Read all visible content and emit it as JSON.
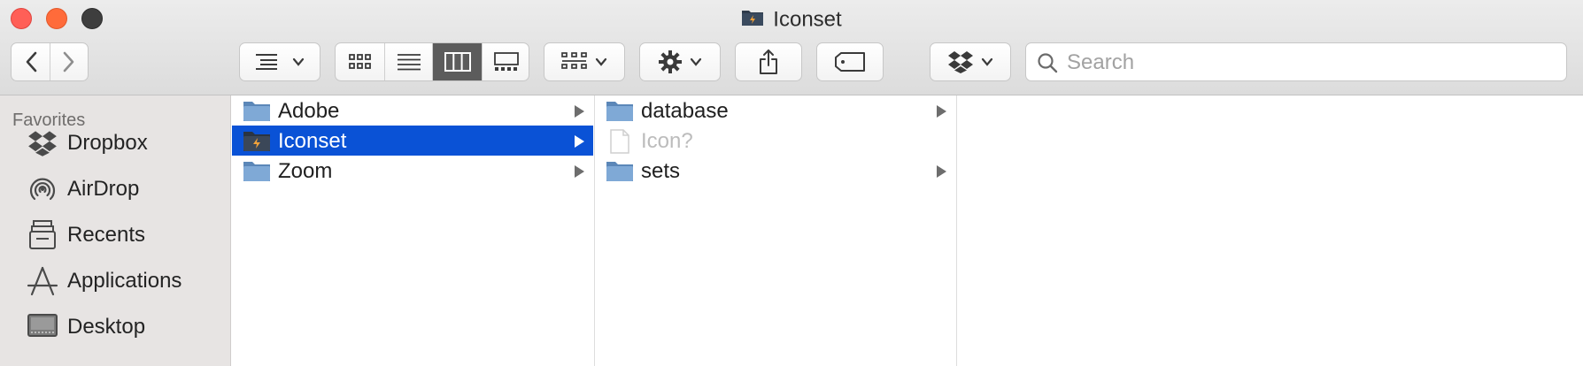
{
  "window": {
    "title": "Iconset",
    "title_icon": "dark-folder-icon"
  },
  "toolbar": {
    "back": "chevron-left-icon",
    "forward": "chevron-right-icon",
    "sort_menu": "list-sort-icon",
    "view_modes": [
      "icon-view-icon",
      "list-view-icon",
      "column-view-icon",
      "gallery-view-icon"
    ],
    "active_view": "column-view-icon",
    "group_menu": "group-icon",
    "action_menu": "gear-icon",
    "share": "share-icon",
    "tags": "tag-icon",
    "dropbox_menu": "dropbox-icon",
    "search_placeholder": "Search"
  },
  "sidebar": {
    "heading": "Favorites",
    "items": [
      {
        "label": "Dropbox",
        "icon": "dropbox-icon"
      },
      {
        "label": "AirDrop",
        "icon": "airdrop-icon"
      },
      {
        "label": "Recents",
        "icon": "recents-icon"
      },
      {
        "label": "Applications",
        "icon": "applications-icon"
      },
      {
        "label": "Desktop",
        "icon": "desktop-icon"
      }
    ]
  },
  "columns": [
    {
      "rows": [
        {
          "label": "Adobe",
          "icon": "folder-icon",
          "has_children": true,
          "selected": false
        },
        {
          "label": "Iconset",
          "icon": "dark-folder-icon",
          "has_children": true,
          "selected": true
        },
        {
          "label": "Zoom",
          "icon": "folder-icon",
          "has_children": true,
          "selected": false
        }
      ]
    },
    {
      "rows": [
        {
          "label": "database",
          "icon": "folder-icon",
          "has_children": true,
          "selected": false
        },
        {
          "label": "Icon?",
          "icon": "document-icon",
          "has_children": false,
          "selected": false
        },
        {
          "label": "sets",
          "icon": "folder-icon",
          "has_children": true,
          "selected": false
        }
      ]
    },
    {
      "rows": []
    }
  ],
  "colors": {
    "selection": "#0a52d6",
    "sidebar_bg": "#e7e4e3",
    "folder_blue": "#6f9fd1"
  }
}
